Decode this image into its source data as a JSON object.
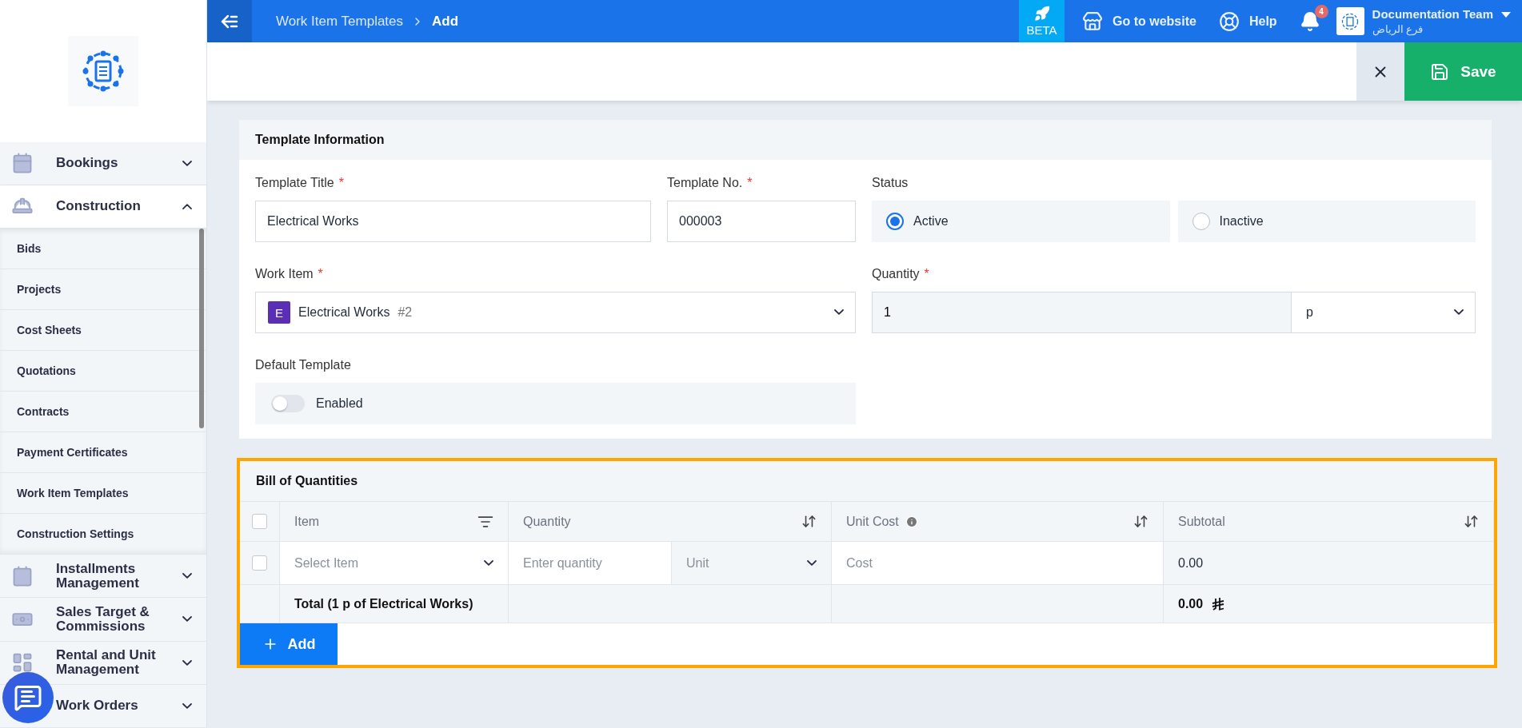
{
  "sidebar": {
    "groups": [
      {
        "label": "Bookings",
        "expanded": false
      },
      {
        "label": "Construction",
        "expanded": true,
        "children": [
          {
            "label": "Bids",
            "selected": false
          },
          {
            "label": "Projects",
            "selected": false
          },
          {
            "label": "Cost Sheets",
            "selected": false
          },
          {
            "label": "Quotations",
            "selected": false
          },
          {
            "label": "Contracts",
            "selected": false
          },
          {
            "label": "Payment Certificates",
            "selected": false
          },
          {
            "label": "Work Item Templates",
            "selected": false
          },
          {
            "label": "Construction Settings",
            "selected": false
          }
        ]
      },
      {
        "label": "Installments Management",
        "expanded": false
      },
      {
        "label": "Sales Target & Commissions",
        "expanded": false
      },
      {
        "label": "Rental and Unit Management",
        "expanded": false
      },
      {
        "label": "Work Orders",
        "expanded": false
      }
    ]
  },
  "topbar": {
    "breadcrumb": [
      "Work Item Templates",
      "Add"
    ],
    "beta": "BETA",
    "website": "Go to website",
    "help": "Help",
    "notifications": "4",
    "account": {
      "name": "Documentation Team",
      "branch": "فرع الرياض"
    }
  },
  "actions": {
    "save": "Save"
  },
  "template_info": {
    "title": "Template Information",
    "template_title": {
      "label": "Template Title",
      "required_mark": "*",
      "value": "Electrical Works"
    },
    "template_no": {
      "label": "Template No.",
      "required_mark": "*",
      "value": "000003"
    },
    "status": {
      "label": "Status",
      "options": [
        {
          "label": "Active",
          "selected": true
        },
        {
          "label": "Inactive",
          "selected": false
        }
      ]
    },
    "work_item": {
      "label": "Work Item",
      "required_mark": "*",
      "badge": "E",
      "value": "Electrical Works",
      "number": "#2"
    },
    "quantity": {
      "label": "Quantity",
      "required_mark": "*",
      "value": "1",
      "unit": "p"
    },
    "default_template": {
      "label": "Default Template",
      "toggle_label": "Enabled",
      "on": false
    }
  },
  "bill": {
    "title": "Bill of Quantities",
    "highlighted": true,
    "columns": [
      {
        "label": "Item",
        "kind": "filter"
      },
      {
        "label": "Quantity",
        "kind": "sort"
      },
      {
        "label": "Unit Cost",
        "kind": "sort",
        "info": true
      },
      {
        "label": "Subtotal",
        "kind": "sort"
      }
    ],
    "header_checked": false,
    "rows": [
      {
        "checked": false,
        "item_placeholder": "Select Item",
        "quantity_placeholder": "Enter quantity",
        "unit_placeholder": "Unit",
        "cost_placeholder": "Cost",
        "subtotal": "0.00"
      }
    ],
    "total": {
      "label": "Total (1 p of Electrical Works)",
      "value": "0.00"
    },
    "add": "Add"
  }
}
